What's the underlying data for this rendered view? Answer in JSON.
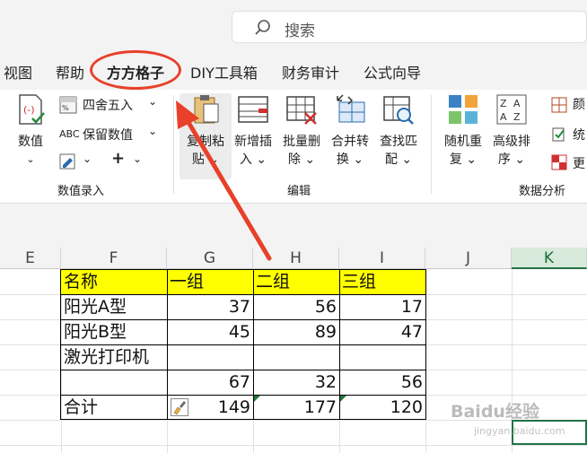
{
  "search": {
    "placeholder": "搜索"
  },
  "tabs": [
    "视图",
    "帮助",
    "方方格子",
    "DIY工具箱",
    "财务审计",
    "公式向导"
  ],
  "ribbon": {
    "value_group": {
      "label": "数值录入",
      "value_button": "数值",
      "round_label": "四舍五入",
      "keep_value_label": "保留数值",
      "abc_label": "ABC",
      "plus_label": "+"
    },
    "edit_group": {
      "label": "编辑",
      "buttons": [
        {
          "line1": "复制粘",
          "line2": "贴"
        },
        {
          "line1": "新增插",
          "line2": "入"
        },
        {
          "line1": "批量删",
          "line2": "除"
        },
        {
          "line1": "合并转",
          "line2": "换"
        },
        {
          "line1": "查找匹",
          "line2": "配"
        }
      ]
    },
    "analysis_group": {
      "label": "数据分析",
      "buttons": [
        {
          "line1": "随机重",
          "line2": "复"
        },
        {
          "line1": "高级排",
          "line2": "序"
        }
      ],
      "side_items": [
        "颜",
        "统",
        "更"
      ]
    }
  },
  "sheet": {
    "columns": [
      "E",
      "F",
      "G",
      "H",
      "I",
      "J",
      "K"
    ],
    "selected_column": "K",
    "header_row": [
      "名称",
      "一组",
      "二组",
      "三组"
    ],
    "rows": [
      [
        "阳光A型",
        "37",
        "56",
        "17"
      ],
      [
        "阳光B型",
        "45",
        "89",
        "47"
      ],
      [
        "激光打印机",
        "",
        "",
        ""
      ],
      [
        "",
        "67",
        "32",
        "56"
      ],
      [
        "合计",
        "149",
        "177",
        "120"
      ]
    ],
    "header_fill": "#ffff00"
  },
  "watermark": {
    "line1": "Baidu经验",
    "line2": "jingyan.baidu.com"
  },
  "annotation": {
    "arrow_color": "#e8402a",
    "highlight_tab": "方方格子"
  }
}
